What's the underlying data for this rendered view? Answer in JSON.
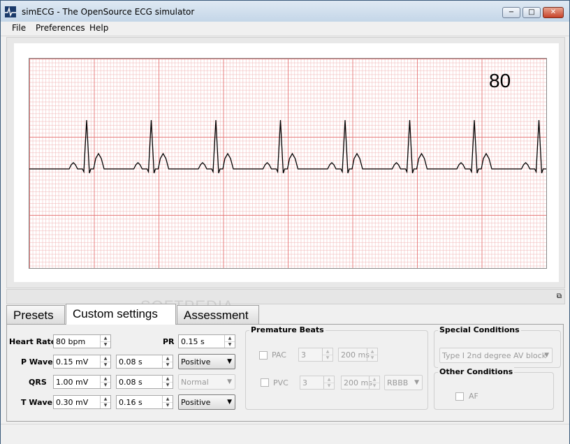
{
  "window": {
    "title": "simECG - The OpenSource ECG simulator",
    "controls": {
      "minimize": "−",
      "maximize": "□",
      "close": "✕"
    }
  },
  "menu": [
    "File",
    "Preferences",
    "Help"
  ],
  "monitor": {
    "heart_rate_display": "80",
    "beats": 8
  },
  "tabs": [
    {
      "label": "Presets",
      "active": false
    },
    {
      "label": "Custom settings",
      "active": true
    },
    {
      "label": "Assessment",
      "active": false
    }
  ],
  "watermark": "SOFTPEDIA",
  "custom": {
    "heart_rate": {
      "label": "Heart Rate",
      "value": "80 bpm"
    },
    "pr": {
      "label": "PR",
      "value": "0.15 s"
    },
    "p_wave": {
      "label": "P Wave",
      "amplitude": "0.15 mV",
      "duration": "0.08 s",
      "polarity": "Positive"
    },
    "qrs": {
      "label": "QRS",
      "amplitude": "1.00 mV",
      "duration": "0.08 s",
      "morphology": "Normal"
    },
    "t_wave": {
      "label": "T Wave",
      "amplitude": "0.30 mV",
      "duration": "0.16 s",
      "polarity": "Positive"
    }
  },
  "premature": {
    "title": "Premature Beats",
    "pac": {
      "label": "PAC",
      "count": "3",
      "interval": "200 ms"
    },
    "pvc": {
      "label": "PVC",
      "count": "3",
      "interval": "200 ms",
      "morphology": "RBBB"
    }
  },
  "special": {
    "title": "Special Conditions",
    "selected": "Type I 2nd degree AV block"
  },
  "other": {
    "title": "Other Conditions",
    "af": {
      "label": "AF"
    }
  },
  "colors": {
    "grid_major": "#e67878",
    "grid_minor": "#f0b4b4",
    "trace": "#000000"
  },
  "icons": [
    "app-icon",
    "restore-icon",
    "chevron-down-icon",
    "spin-up-icon",
    "spin-down-icon"
  ]
}
